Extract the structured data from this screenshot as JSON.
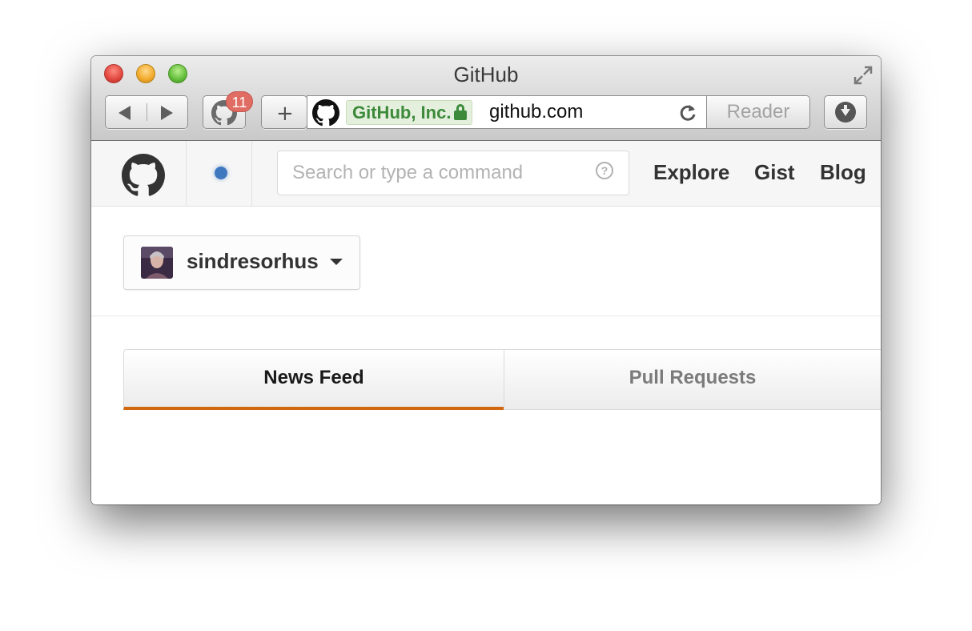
{
  "window": {
    "title": "GitHub"
  },
  "toolbar": {
    "extension_badge_count": "11",
    "new_tab_label": "+",
    "reader_label": "Reader"
  },
  "address_bar": {
    "ev_certificate": "GitHub, Inc.",
    "url": "github.com"
  },
  "site_header": {
    "search_placeholder": "Search or type a command",
    "help_glyph": "?",
    "nav": [
      {
        "label": "Explore"
      },
      {
        "label": "Gist"
      },
      {
        "label": "Blog"
      }
    ],
    "notification_color": "#4078c0"
  },
  "dashboard": {
    "context_user": "sindresorhus",
    "tabs": [
      {
        "label": "News Feed",
        "selected": true
      },
      {
        "label": "Pull Requests",
        "selected": false
      }
    ],
    "active_tab_accent": "#d26911"
  }
}
